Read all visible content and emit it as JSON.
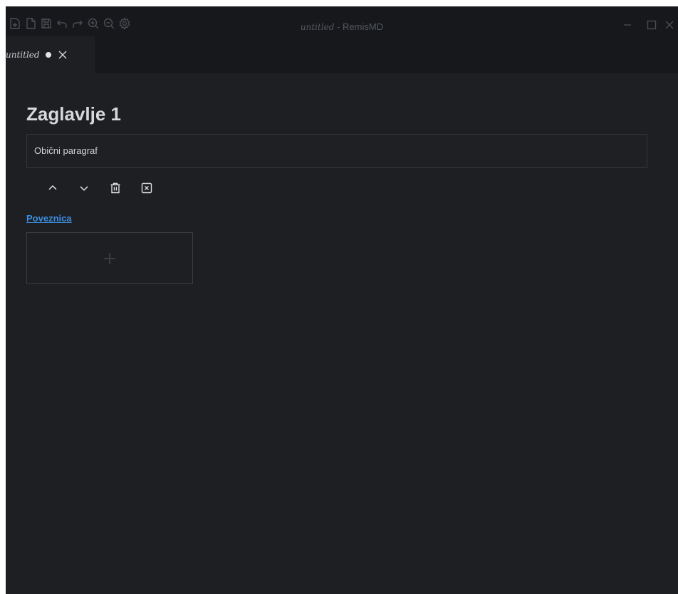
{
  "window": {
    "title_filename": "untitled",
    "title_separator": " - ",
    "title_app": "RemisMD"
  },
  "toolbar": {
    "icons": [
      "new-file-icon",
      "new-document-icon",
      "save-icon",
      "undo-icon",
      "redo-icon",
      "zoom-in-icon",
      "zoom-out-icon",
      "settings-gear-icon"
    ]
  },
  "tabs": [
    {
      "label": "untitled",
      "modified": true,
      "close_icon": "close-icon"
    }
  ],
  "document": {
    "heading": "Zaglavlje 1",
    "paragraph": "Obični paragraf",
    "block_tools": [
      "move-up-icon",
      "move-down-icon",
      "delete-trash-icon",
      "remove-block-icon"
    ],
    "link_text": "Poveznica",
    "add_block_icon": "plus-icon"
  },
  "colors": {
    "background": "#1e1f23",
    "titlebar": "#17181b",
    "link": "#3d8fe0",
    "text": "#d7d8db"
  }
}
